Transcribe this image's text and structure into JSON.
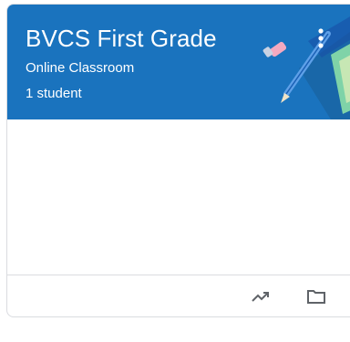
{
  "card": {
    "title": "BVCS First Grade",
    "section": "Online Classroom",
    "student_count": "1 student",
    "header_color": "#1a73be"
  },
  "icons": {
    "more": "more-vert-icon",
    "gradebook": "trending-up-icon",
    "folder": "folder-icon"
  }
}
